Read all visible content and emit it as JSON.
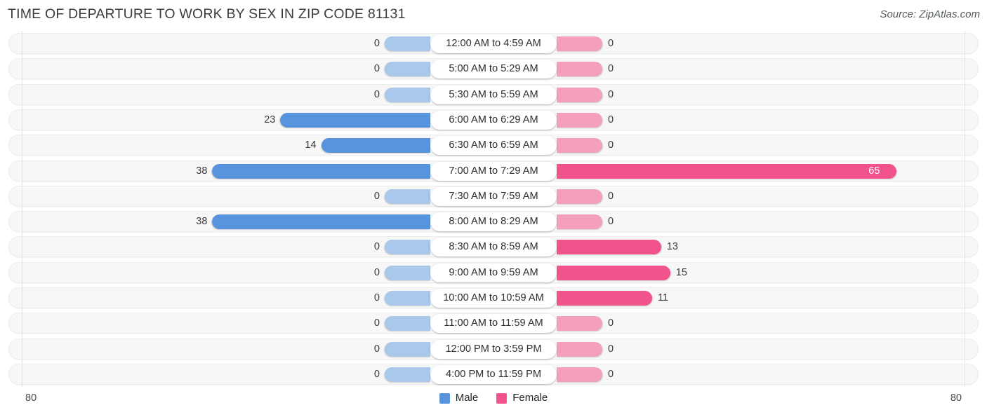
{
  "header": {
    "title": "TIME OF DEPARTURE TO WORK BY SEX IN ZIP CODE 81131",
    "source": "Source: ZipAtlas.com"
  },
  "legend": {
    "male": {
      "label": "Male",
      "color": "#5794dd"
    },
    "female": {
      "label": "Female",
      "color": "#f1548c"
    }
  },
  "axis": {
    "left_tick": "80",
    "right_tick": "80"
  },
  "colors": {
    "male_strong": "#5794dd",
    "male_light": "#a9c8ea",
    "female_strong": "#f1548c",
    "female_light": "#f4a0bd",
    "track": "#f7f7f7",
    "gridline": "#e2e2e2"
  },
  "chart_data": {
    "type": "bar",
    "subtype": "diverging-bidirectional",
    "title": "TIME OF DEPARTURE TO WORK BY SEX IN ZIP CODE 81131",
    "xlabel": "",
    "ylabel": "",
    "xlim": [
      80,
      80
    ],
    "grid": true,
    "legend_position": "bottom-center",
    "categories": [
      "12:00 AM to 4:59 AM",
      "5:00 AM to 5:29 AM",
      "5:30 AM to 5:59 AM",
      "6:00 AM to 6:29 AM",
      "6:30 AM to 6:59 AM",
      "7:00 AM to 7:29 AM",
      "7:30 AM to 7:59 AM",
      "8:00 AM to 8:29 AM",
      "8:30 AM to 8:59 AM",
      "9:00 AM to 9:59 AM",
      "10:00 AM to 10:59 AM",
      "11:00 AM to 11:59 AM",
      "12:00 PM to 3:59 PM",
      "4:00 PM to 11:59 PM"
    ],
    "series": [
      {
        "name": "Male",
        "color": "#5794dd",
        "direction": "left",
        "values": [
          0,
          0,
          0,
          23,
          14,
          38,
          0,
          38,
          0,
          0,
          0,
          0,
          0,
          0
        ]
      },
      {
        "name": "Female",
        "color": "#f1548c",
        "direction": "right",
        "values": [
          0,
          0,
          0,
          0,
          0,
          65,
          0,
          0,
          13,
          15,
          11,
          0,
          0,
          0
        ]
      }
    ]
  }
}
